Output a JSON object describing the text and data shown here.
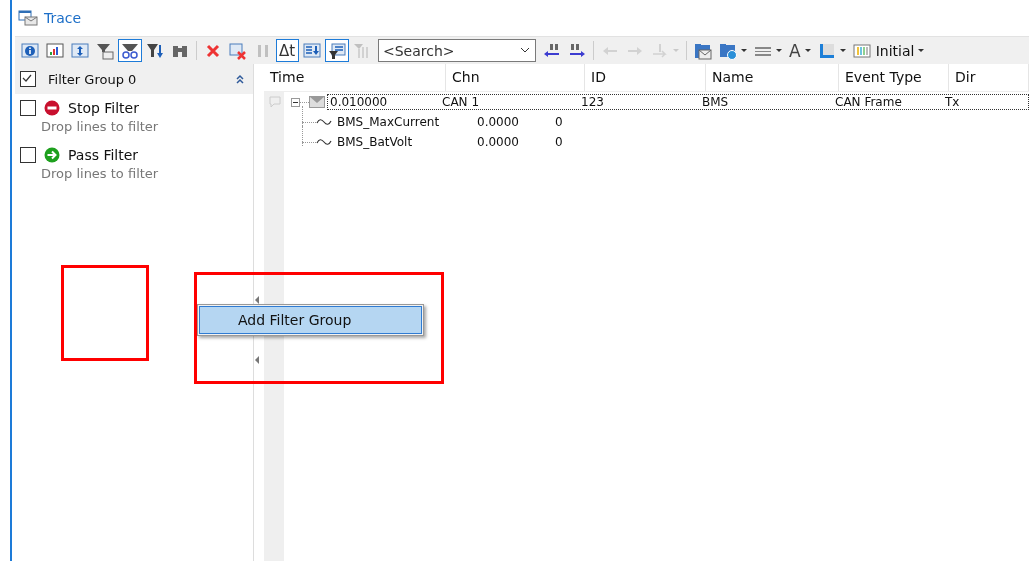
{
  "window": {
    "title": "Trace"
  },
  "toolbar": {
    "left": [
      {
        "kind": "info",
        "selected": false,
        "disabled": false
      },
      {
        "kind": "chart",
        "selected": false,
        "disabled": false
      },
      {
        "kind": "expand",
        "selected": false,
        "disabled": false
      },
      {
        "kind": "filter-mail",
        "selected": false,
        "disabled": false
      },
      {
        "kind": "filter-glasses",
        "selected": true,
        "disabled": false
      },
      {
        "kind": "filter-down",
        "selected": false,
        "disabled": false
      },
      {
        "kind": "binoculars",
        "selected": false,
        "disabled": false
      },
      {
        "kind": "sep"
      },
      {
        "kind": "delete",
        "selected": false,
        "disabled": false
      },
      {
        "kind": "clear",
        "selected": false,
        "disabled": false
      },
      {
        "kind": "pause",
        "selected": false,
        "disabled": true
      },
      {
        "kind": "text",
        "label": "Δt",
        "selected": true,
        "disabled": false
      },
      {
        "kind": "sort",
        "selected": false,
        "disabled": false
      },
      {
        "kind": "filter-list",
        "selected": true,
        "disabled": false
      },
      {
        "kind": "bars",
        "selected": false,
        "disabled": true
      }
    ],
    "search": {
      "placeholder": "<Search>"
    },
    "right": [
      {
        "kind": "find-prev",
        "selected": false,
        "disabled": false
      },
      {
        "kind": "find-next",
        "selected": false,
        "disabled": false
      },
      {
        "kind": "sep"
      },
      {
        "kind": "arrow-left",
        "selected": false,
        "disabled": true
      },
      {
        "kind": "arrow-right",
        "selected": false,
        "disabled": true
      },
      {
        "kind": "insert",
        "selected": false,
        "disabled": true,
        "dropdown": true
      },
      {
        "kind": "sep"
      },
      {
        "kind": "folder-mail",
        "selected": false,
        "disabled": false
      },
      {
        "kind": "folder-globe",
        "selected": false,
        "disabled": false,
        "dropdown": true
      },
      {
        "kind": "lines",
        "selected": false,
        "disabled": false,
        "dropdown": true
      },
      {
        "kind": "text",
        "label": "A",
        "selected": false,
        "disabled": false,
        "dropdown": true
      },
      {
        "kind": "layout",
        "selected": false,
        "disabled": false,
        "dropdown": true
      },
      {
        "kind": "columns",
        "label": "Initial",
        "selected": false,
        "disabled": false,
        "dropdown": true
      }
    ]
  },
  "filter_panel": {
    "group": {
      "label": "Filter Group 0",
      "checked": true
    },
    "filters": [
      {
        "kind": "stop",
        "label": "Stop Filter",
        "hint": "Drop lines to filter",
        "checked": false
      },
      {
        "kind": "pass",
        "label": "Pass Filter",
        "hint": "Drop lines to filter",
        "checked": false
      }
    ]
  },
  "table": {
    "columns": [
      "Time",
      "Chn",
      "ID",
      "Name",
      "Event Type",
      "Dir"
    ],
    "rows": [
      {
        "expanded": true,
        "cells": [
          "0.010000",
          "CAN 1",
          "123",
          "BMS",
          "CAN Frame",
          "Tx"
        ],
        "children": [
          {
            "name": "BMS_MaxCurrent",
            "value": "0.0000",
            "raw": "0"
          },
          {
            "name": "BMS_BatVolt",
            "value": "0.0000",
            "raw": "0"
          }
        ]
      }
    ]
  },
  "context_menu": {
    "items": [
      {
        "label": "Add Filter Group",
        "selected": true
      }
    ]
  }
}
